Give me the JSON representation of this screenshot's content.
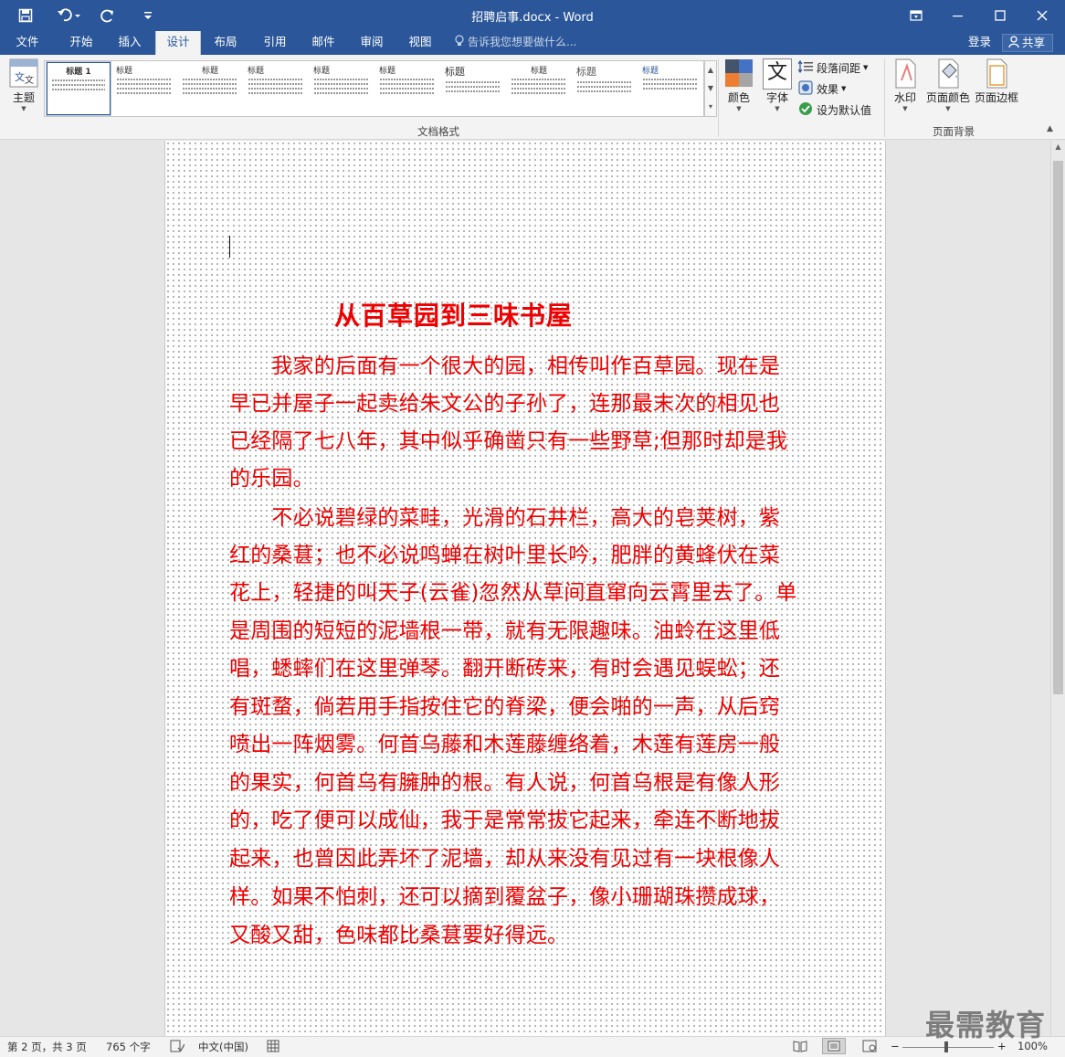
{
  "window": {
    "title": "招聘启事.docx - Word"
  },
  "tabs": [
    {
      "label": "文件"
    },
    {
      "label": "开始"
    },
    {
      "label": "插入"
    },
    {
      "label": "设计"
    },
    {
      "label": "布局"
    },
    {
      "label": "引用"
    },
    {
      "label": "邮件"
    },
    {
      "label": "审阅"
    },
    {
      "label": "视图"
    }
  ],
  "active_tab": "设计",
  "tell_me": "告诉我您想要做什么...",
  "account": {
    "login": "登录",
    "share": "共享"
  },
  "ribbon": {
    "theme_label": "主题",
    "gallery_items": [
      {
        "title": "标题 1"
      },
      {
        "title": "标题"
      },
      {
        "title": "标题"
      },
      {
        "title": "标题"
      },
      {
        "title": "标题"
      },
      {
        "title": "标题"
      },
      {
        "title": "标题"
      },
      {
        "title": "标题"
      },
      {
        "title": "标题"
      },
      {
        "title": "标题"
      }
    ],
    "doc_format_label": "文档格式",
    "colors_label": "颜色",
    "fonts_label": "字体",
    "fonts_glyph": "文",
    "para_spacing_label": "段落间距",
    "effects_label": "效果",
    "set_default_label": "设为默认值",
    "watermark_label": "水印",
    "page_color_label": "页面颜色",
    "page_border_label": "页面边框",
    "page_bg_label": "页面背景"
  },
  "document": {
    "title": "从百草园到三味书屋",
    "lines": [
      "　　我家的后面有一个很大的园，相传叫作百草园。现在是",
      "早已并屋子一起卖给朱文公的子孙了，连那最末次的相见也",
      "已经隔了七八年，其中似乎确凿只有一些野草;但那时却是我",
      "的乐园。",
      "　　不必说碧绿的菜畦，光滑的石井栏，高大的皂荚树，紫",
      "红的桑葚；也不必说鸣蝉在树叶里长吟，肥胖的黄蜂伏在菜",
      "花上，轻捷的叫天子(云雀)忽然从草间直窜向云霄里去了。单",
      "是周围的短短的泥墙根一带，就有无限趣味。油蛉在这里低",
      "唱，蟋蟀们在这里弹琴。翻开断砖来，有时会遇见蜈蚣；还",
      "有斑蝥，倘若用手指按住它的脊梁，便会啪的一声，从后窍",
      "喷出一阵烟雾。何首乌藤和木莲藤缠络着，木莲有莲房一般",
      "的果实，何首乌有臃肿的根。有人说，何首乌根是有像人形",
      "的，吃了便可以成仙，我于是常常拔它起来，牵连不断地拔",
      "起来，也曾因此弄坏了泥墙，却从来没有见过有一块根像人",
      "样。如果不怕刺，还可以摘到覆盆子，像小珊瑚珠攒成球，",
      "又酸又甜，色味都比桑葚要好得远。"
    ],
    "text_color": "#ee0000"
  },
  "status": {
    "page": "第 2 页，共 3 页",
    "words": "765 个字",
    "language": "中文(中国)",
    "zoom": "100%"
  },
  "watermark_text": "最需教育"
}
